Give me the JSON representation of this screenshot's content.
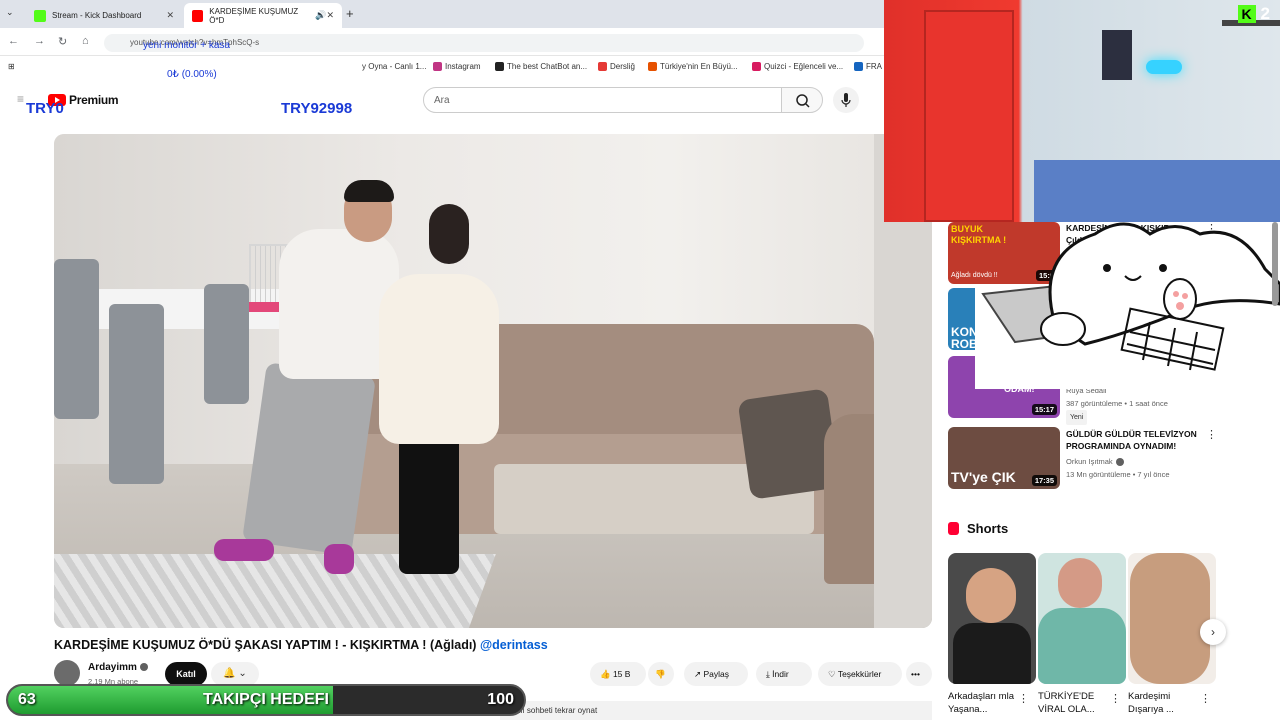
{
  "browser": {
    "tabs": [
      {
        "title": "Stream - Kick Dashboard",
        "favicon_color": "#53fc18"
      },
      {
        "title": "KARDEŞİME KUŞUMUZ Ö*D",
        "favicon_color": "#ff0000"
      }
    ],
    "url": "youtube.com/watch?v=hmTphScQ-s",
    "bookmarks": [
      {
        "label": "y Oyna - Canlı 1...",
        "color": "#e74c3c"
      },
      {
        "label": "Instagram",
        "color": "#c13584"
      },
      {
        "label": "The best ChatBot an...",
        "color": "#222222"
      },
      {
        "label": "Dersliğ",
        "color": "#e53935"
      },
      {
        "label": "Türkiye'nin En Büyü...",
        "color": "#e65100"
      },
      {
        "label": "Quizci - Eğlenceli ve...",
        "color": "#d81b60"
      },
      {
        "label": "FRA",
        "color": "#1565c0"
      }
    ]
  },
  "overlay": {
    "monitor_label": "yeni monitör + kasa",
    "monitor_progress": "0₺ (0.00%)",
    "try_left": "TRY0",
    "try_right": "TRY92998"
  },
  "header": {
    "logo_text": "Premium",
    "search_placeholder": "Ara"
  },
  "video": {
    "title": "KARDEŞİME KUŞUMUZ Ö*DÜ ŞAKASI YAPTIM ! - KIŞKIRTMA ! (Ağladı) ",
    "mention": "@derintass",
    "channel": "Ardayimm",
    "subs": "2,19 Mn abone",
    "join_label": "Katıl",
    "bell_label": "🔔 ⌄",
    "likes": "15 B",
    "share": "Paylaş",
    "download": "İndir",
    "thanks": "Teşekkürler",
    "more": "•••",
    "chat_replay": "Canlı sohbeti tekrar oynat"
  },
  "kick": {
    "letter": "K",
    "viewers": "2"
  },
  "recommended": [
    {
      "thumb_text": "BUYUK KIŞKIRTMA !",
      "thumb_sub": "Ağladı dövdü !!",
      "duration": "15:0",
      "title": "KARDEŞİM... ANE KIŞKIR... Çıldırdı ...",
      "thumb_color": "#c0392b"
    },
    {
      "thumb_text": "KON ROB",
      "duration": "",
      "title": "",
      "thumb_color": "#2980b9"
    },
    {
      "thumb_text": "ODAM!",
      "duration": "15:17",
      "channel": "Ruya Sedali",
      "meta": "387 görüntüleme • 1 saat önce",
      "badge": "Yeni",
      "thumb_color": "#8e44ad"
    },
    {
      "thumb_text": "TV'ye ÇIK",
      "duration": "17:35",
      "title": "GÜLDÜR GÜLDÜR TELEVİZYON PROGRAMINDA OYNADIM!",
      "channel": "Orkun Işıtmak",
      "meta": "13 Mn görüntüleme • 7 yıl önce",
      "thumb_color": "#6d4c41"
    }
  ],
  "shorts": {
    "heading": "Shorts",
    "items": [
      {
        "title": "Arkadaşları mla Yaşana...",
        "color": "#4a4a4a"
      },
      {
        "title": "TÜRKİYE'DE VİRAL OLA...",
        "color": "#6fb7a8"
      },
      {
        "title": "Kardeşimi Dışarıya ...",
        "color": "#c79d7e"
      }
    ]
  },
  "goal": {
    "label": "TAKIPÇI HEDEFI",
    "current": "63",
    "target": "100",
    "progress": 0.63
  }
}
